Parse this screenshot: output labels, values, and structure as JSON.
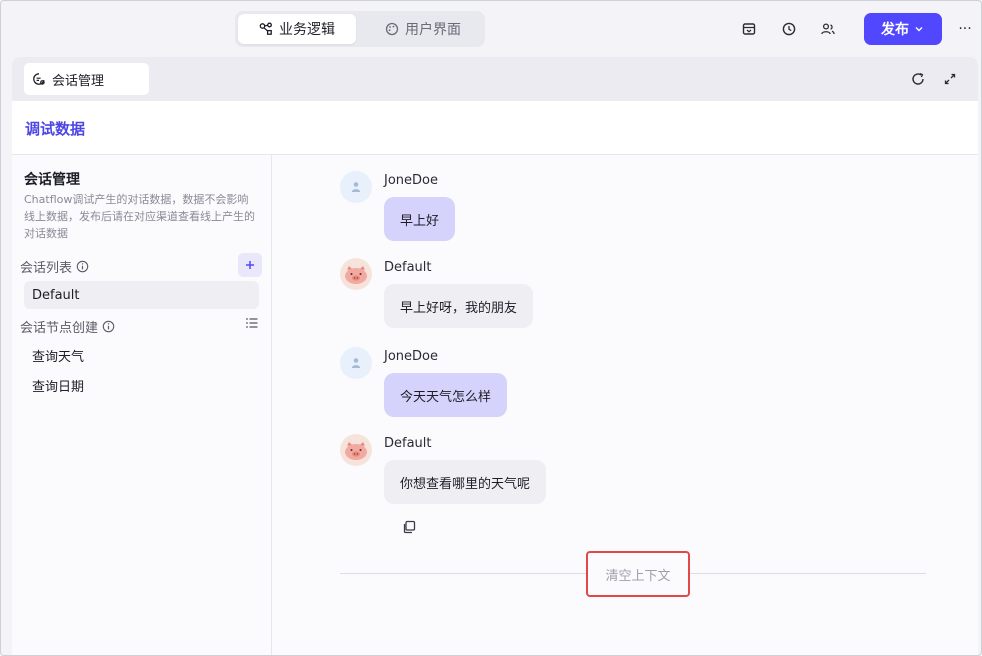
{
  "header": {
    "tabs": [
      {
        "label": "业务逻辑",
        "icon": "workflow-icon",
        "active": true
      },
      {
        "label": "用户界面",
        "icon": "palette-icon",
        "active": false
      }
    ],
    "actions": [
      "archive-icon",
      "history-icon",
      "users-icon"
    ],
    "publish_label": "发布",
    "more_label": "···"
  },
  "panel": {
    "tab_label": "会话管理",
    "section_title": "调试数据"
  },
  "sidebar": {
    "title": "会话管理",
    "description": "Chatflow调试产生的对话数据，数据不会影响线上数据，发布后请在对应渠道查看线上产生的对话数据",
    "conversation_list_label": "会话列表",
    "conversations": [
      {
        "label": "Default",
        "selected": true
      }
    ],
    "node_create_label": "会话节点创建",
    "nodes": [
      {
        "label": "查询天气"
      },
      {
        "label": "查询日期"
      }
    ]
  },
  "chat": {
    "messages": [
      {
        "role": "user",
        "sender": "JoneDoe",
        "text": "早上好"
      },
      {
        "role": "bot",
        "sender": "Default",
        "text": "早上好呀，我的朋友"
      },
      {
        "role": "user",
        "sender": "JoneDoe",
        "text": "今天天气怎么样"
      },
      {
        "role": "bot",
        "sender": "Default",
        "text": "你想查看哪里的天气呢"
      }
    ],
    "clear_context_label": "清空上下文"
  },
  "colors": {
    "accent": "#5147ff",
    "user_bubble": "#d5d3fb",
    "bot_bubble": "#efeff3",
    "highlight": "#e0484a"
  }
}
